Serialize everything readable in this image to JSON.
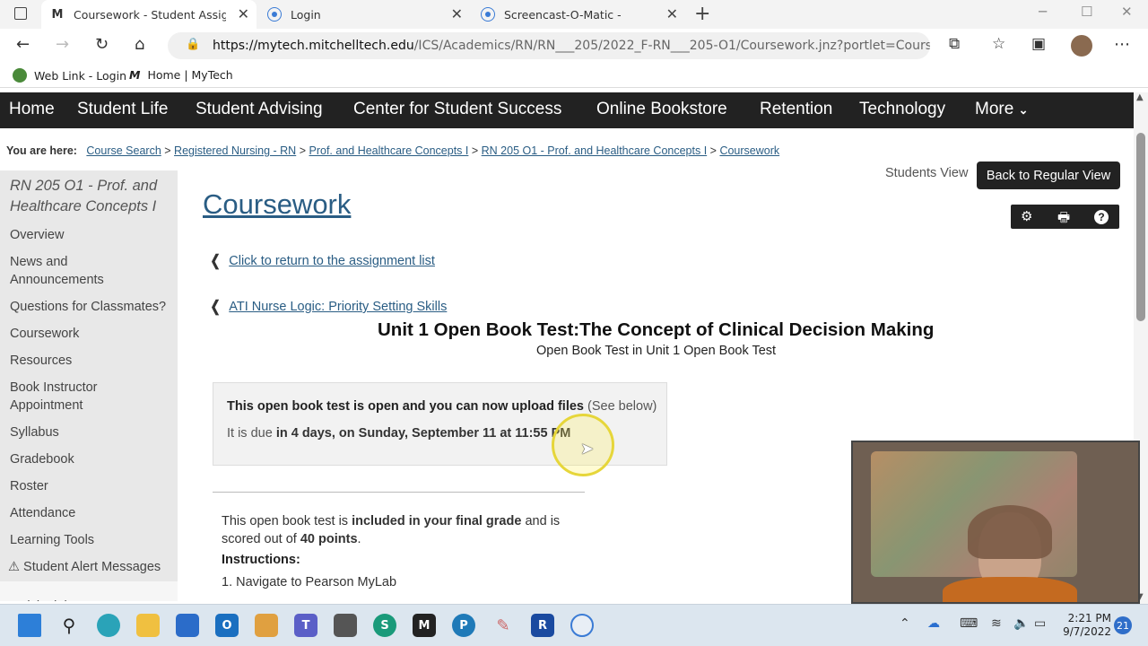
{
  "browser": {
    "tabs": [
      {
        "title": "Coursework - Student Assignme",
        "favicon": "M"
      },
      {
        "title": "Login",
        "favicon": "circle"
      },
      {
        "title": "Screencast-O-Matic -",
        "favicon": "circle"
      }
    ],
    "new_tab": "+",
    "url_host": "https://mytech.mitchelltech.edu",
    "url_path": "/ICS/Academics/RN/RN___205/2022_F-RN___205-O1/Coursework.jnz?portlet=Cours...",
    "bookmarks": [
      {
        "label": "Web Link - Login"
      },
      {
        "label": "Home | MyTech"
      }
    ]
  },
  "site_nav": [
    "Home",
    "Student Life",
    "Student Advising",
    "Center for Student Success",
    "Online Bookstore",
    "Retention",
    "Technology",
    "More"
  ],
  "breadcrumb": {
    "prefix": "You are here:",
    "items": [
      "Course Search",
      "Registered Nursing - RN",
      "Prof. and Healthcare Concepts I",
      "RN 205 O1 - Prof. and Healthcare Concepts I",
      "Coursework"
    ],
    "sep": ">"
  },
  "sidebar": {
    "course_title": "RN 205 O1 - Prof. and Healthcare Concepts I",
    "items": [
      "Overview",
      "News and Announcements",
      "Questions for Classmates?",
      "Coursework",
      "Resources",
      "Book Instructor Appointment",
      "Syllabus",
      "Gradebook",
      "Roster",
      "Attendance",
      "Learning Tools",
      "Student Alert Messages"
    ],
    "cutoff": "Quick Links"
  },
  "main": {
    "page_title": "Coursework",
    "students_view": "Students View",
    "back_button": "Back to Regular View",
    "return_link": "Click to return to the assignment list",
    "prev_link": "ATI Nurse Logic: Priority Setting Skills",
    "test_title": "Unit 1 Open Book Test:The Concept of Clinical Decision Making",
    "test_subtitle": "Open Book Test in Unit 1 Open Book Test",
    "status_bold": "This open book test is open and you can now upload files",
    "status_note": "(See below)",
    "due_prefix": "It is due",
    "due_bold": "in 4 days, on Sunday, September 11 at 11:55 PM",
    "grade_pre": "This open book test is",
    "grade_bold": "included in your final grade",
    "grade_mid": "and is scored out of",
    "points": "40 points",
    "grade_end": ".",
    "instructions_label": "Instructions:",
    "step1": "1. Navigate to Pearson MyLab"
  },
  "taskbar": {
    "time": "2:21 PM",
    "date": "9/7/2022",
    "notifications": "21"
  }
}
